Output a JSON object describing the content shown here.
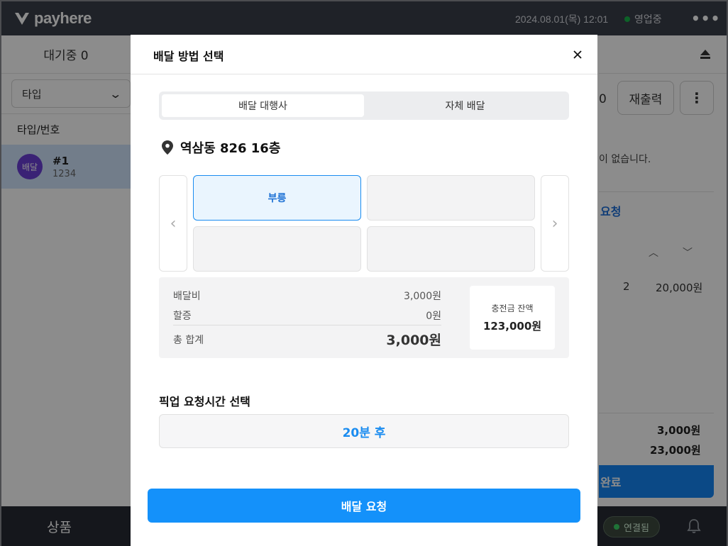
{
  "topbar": {
    "logo_text": "payhere",
    "datetime": "2024.08.01(목) 12:01",
    "status_text": "영업중",
    "more_icon": "more-horizontal-icon",
    "status_color": "#19b34a"
  },
  "left_panel": {
    "tab_label": "대기중 0",
    "type_filter": "타입",
    "column_header": "타입/번호",
    "order": {
      "badge": "배달",
      "number": "#1",
      "sub": "1234"
    }
  },
  "right_panel": {
    "count_fragment": "0",
    "reprint_label": "재출력",
    "empty_message_fragment": "이 없습니다.",
    "request_link_fragment": "요청",
    "item_qty": "2",
    "item_price": "20,000원",
    "subtotal": "3,000원",
    "total": "23,000원",
    "complete_fragment": "완료"
  },
  "bottom_bar": {
    "goods_label": "상품",
    "connection_status": "연결됨"
  },
  "modal": {
    "title": "배달 방법 선택",
    "close_icon": "close-icon",
    "tabs": [
      {
        "label": "배달 대행사",
        "active": true
      },
      {
        "label": "자체 배달",
        "active": false
      }
    ],
    "address": "역삼동 826 16층",
    "agencies": [
      {
        "label": "부릉",
        "selected": true
      },
      {
        "label": "",
        "selected": false
      },
      {
        "label": "",
        "selected": false
      },
      {
        "label": "",
        "selected": false
      }
    ],
    "fees": {
      "delivery_fee_label": "배달비",
      "delivery_fee_value": "3,000원",
      "surcharge_label": "할증",
      "surcharge_value": "0원",
      "total_label": "총 합계",
      "total_value": "3,000원"
    },
    "balance": {
      "label": "충전금 잔액",
      "value": "123,000원"
    },
    "pickup": {
      "label": "픽업 요청시간 선택",
      "selected": "20분 후"
    },
    "submit_label": "배달 요청",
    "accent_color": "#1491fa"
  }
}
